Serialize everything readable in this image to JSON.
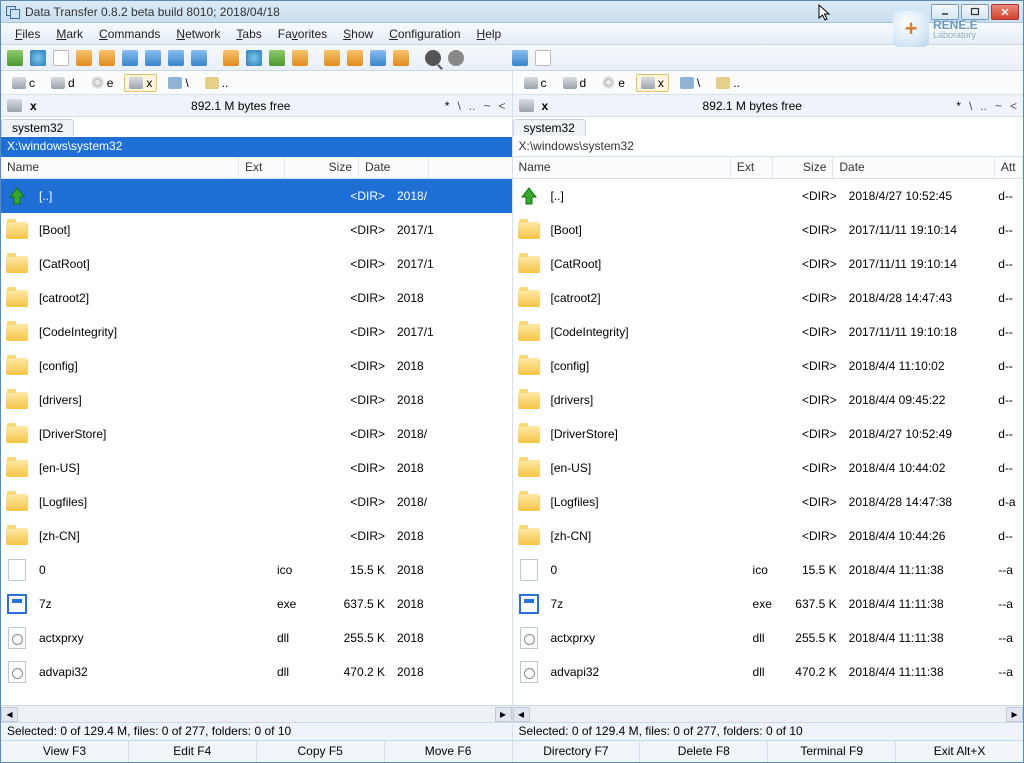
{
  "app": {
    "title": "Data Transfer 0.8.2 beta build 8010; 2018/04/18"
  },
  "logo": {
    "brand": "RENE.E",
    "sub": "Laboratory"
  },
  "menu": [
    {
      "label": "Files",
      "u": 0
    },
    {
      "label": "Mark",
      "u": 0
    },
    {
      "label": "Commands",
      "u": 0
    },
    {
      "label": "Network",
      "u": 0
    },
    {
      "label": "Tabs",
      "u": 0
    },
    {
      "label": "Favorites",
      "u": 2
    },
    {
      "label": "Show",
      "u": 0
    },
    {
      "label": "Configuration",
      "u": 0
    },
    {
      "label": "Help",
      "u": 0
    }
  ],
  "toolbar_icons": [
    "refresh",
    "world",
    "file",
    "orange",
    "orange",
    "blue",
    "blue",
    "blue",
    "blue",
    "sep",
    "orange",
    "world",
    "refresh",
    "orange",
    "sep",
    "orange",
    "orange",
    "blue",
    "orange",
    "sep",
    "find",
    "gear",
    "sep",
    "drive",
    "sep",
    "blue",
    "file"
  ],
  "drives": {
    "left": [
      {
        "t": "hd",
        "l": "c"
      },
      {
        "t": "hd",
        "l": "d"
      },
      {
        "t": "cd",
        "l": "e"
      },
      {
        "t": "hd",
        "l": "x",
        "active": true
      },
      {
        "t": "net",
        "l": "\\"
      },
      {
        "t": "root",
        "l": ".."
      }
    ],
    "right": [
      {
        "t": "hd",
        "l": "c"
      },
      {
        "t": "hd",
        "l": "d"
      },
      {
        "t": "cd",
        "l": "e"
      },
      {
        "t": "hd",
        "l": "x",
        "active": true
      },
      {
        "t": "net",
        "l": "\\"
      },
      {
        "t": "root",
        "l": ".."
      }
    ]
  },
  "panel": {
    "left": {
      "drive_letter": "x",
      "free": "892.1 M bytes free",
      "nav_star": "*",
      "nav": [
        "\\",
        "..",
        "~",
        "<"
      ],
      "tab": "system32",
      "path": "X:\\windows\\system32",
      "headers": [
        "Name",
        "Ext",
        "Size",
        "Date"
      ],
      "rows": [
        {
          "ico": "up",
          "name": "[..]",
          "ext": "",
          "size": "<DIR>",
          "date": "2018/",
          "sel": true
        },
        {
          "ico": "folder",
          "name": "[Boot]",
          "ext": "",
          "size": "<DIR>",
          "date": "2017/1"
        },
        {
          "ico": "folder",
          "name": "[CatRoot]",
          "ext": "",
          "size": "<DIR>",
          "date": "2017/1"
        },
        {
          "ico": "folder",
          "name": "[catroot2]",
          "ext": "",
          "size": "<DIR>",
          "date": "2018"
        },
        {
          "ico": "folder",
          "name": "[CodeIntegrity]",
          "ext": "",
          "size": "<DIR>",
          "date": "2017/1"
        },
        {
          "ico": "folder",
          "name": "[config]",
          "ext": "",
          "size": "<DIR>",
          "date": "2018"
        },
        {
          "ico": "folder",
          "name": "[drivers]",
          "ext": "",
          "size": "<DIR>",
          "date": "2018"
        },
        {
          "ico": "folder",
          "name": "[DriverStore]",
          "ext": "",
          "size": "<DIR>",
          "date": "2018/"
        },
        {
          "ico": "folder",
          "name": "[en-US]",
          "ext": "",
          "size": "<DIR>",
          "date": "2018"
        },
        {
          "ico": "folder",
          "name": "[Logfiles]",
          "ext": "",
          "size": "<DIR>",
          "date": "2018/"
        },
        {
          "ico": "folder",
          "name": "[zh-CN]",
          "ext": "",
          "size": "<DIR>",
          "date": "2018"
        },
        {
          "ico": "file",
          "name": "0",
          "ext": "ico",
          "size": "15.5 K",
          "date": "2018"
        },
        {
          "ico": "exe",
          "name": "7z",
          "ext": "exe",
          "size": "637.5 K",
          "date": "2018"
        },
        {
          "ico": "dll",
          "name": "actxprxy",
          "ext": "dll",
          "size": "255.5 K",
          "date": "2018"
        },
        {
          "ico": "dll",
          "name": "advapi32",
          "ext": "dll",
          "size": "470.2 K",
          "date": "2018"
        }
      ],
      "status": "Selected: 0 of 129.4 M, files: 0 of 277, folders: 0 of 10"
    },
    "right": {
      "drive_letter": "x",
      "free": "892.1 M bytes free",
      "nav_star": "*",
      "nav": [
        "\\",
        "..",
        "~",
        "<"
      ],
      "tab": "system32",
      "path": "X:\\windows\\system32",
      "headers": [
        "Name",
        "Ext",
        "Size",
        "Date",
        "Att"
      ],
      "rows": [
        {
          "ico": "up",
          "name": "[..]",
          "ext": "",
          "size": "<DIR>",
          "date": "2018/4/27 10:52:45",
          "attr": "d--"
        },
        {
          "ico": "folder",
          "name": "[Boot]",
          "ext": "",
          "size": "<DIR>",
          "date": "2017/11/11 19:10:14",
          "attr": "d--"
        },
        {
          "ico": "folder",
          "name": "[CatRoot]",
          "ext": "",
          "size": "<DIR>",
          "date": "2017/11/11 19:10:14",
          "attr": "d--"
        },
        {
          "ico": "folder",
          "name": "[catroot2]",
          "ext": "",
          "size": "<DIR>",
          "date": "2018/4/28 14:47:43",
          "attr": "d--"
        },
        {
          "ico": "folder",
          "name": "[CodeIntegrity]",
          "ext": "",
          "size": "<DIR>",
          "date": "2017/11/11 19:10:18",
          "attr": "d--"
        },
        {
          "ico": "folder",
          "name": "[config]",
          "ext": "",
          "size": "<DIR>",
          "date": "2018/4/4 11:10:02",
          "attr": "d--"
        },
        {
          "ico": "folder",
          "name": "[drivers]",
          "ext": "",
          "size": "<DIR>",
          "date": "2018/4/4 09:45:22",
          "attr": "d--"
        },
        {
          "ico": "folder",
          "name": "[DriverStore]",
          "ext": "",
          "size": "<DIR>",
          "date": "2018/4/27 10:52:49",
          "attr": "d--"
        },
        {
          "ico": "folder",
          "name": "[en-US]",
          "ext": "",
          "size": "<DIR>",
          "date": "2018/4/4 10:44:02",
          "attr": "d--"
        },
        {
          "ico": "folder",
          "name": "[Logfiles]",
          "ext": "",
          "size": "<DIR>",
          "date": "2018/4/28 14:47:38",
          "attr": "d-a"
        },
        {
          "ico": "folder",
          "name": "[zh-CN]",
          "ext": "",
          "size": "<DIR>",
          "date": "2018/4/4 10:44:26",
          "attr": "d--"
        },
        {
          "ico": "file",
          "name": "0",
          "ext": "ico",
          "size": "15.5 K",
          "date": "2018/4/4 11:11:38",
          "attr": "--a"
        },
        {
          "ico": "exe",
          "name": "7z",
          "ext": "exe",
          "size": "637.5 K",
          "date": "2018/4/4 11:11:38",
          "attr": "--a"
        },
        {
          "ico": "dll",
          "name": "actxprxy",
          "ext": "dll",
          "size": "255.5 K",
          "date": "2018/4/4 11:11:38",
          "attr": "--a"
        },
        {
          "ico": "dll",
          "name": "advapi32",
          "ext": "dll",
          "size": "470.2 K",
          "date": "2018/4/4 11:11:38",
          "attr": "--a"
        }
      ],
      "status": "Selected: 0 of 129.4 M, files: 0 of 277, folders: 0 of 10"
    }
  },
  "fnkeys": [
    {
      "l": "View F3"
    },
    {
      "l": "Edit F4"
    },
    {
      "l": "Copy F5"
    },
    {
      "l": "Move F6"
    },
    {
      "l": "Directory F7"
    },
    {
      "l": "Delete F8"
    },
    {
      "l": "Terminal F9"
    },
    {
      "l": "Exit Alt+X"
    }
  ]
}
